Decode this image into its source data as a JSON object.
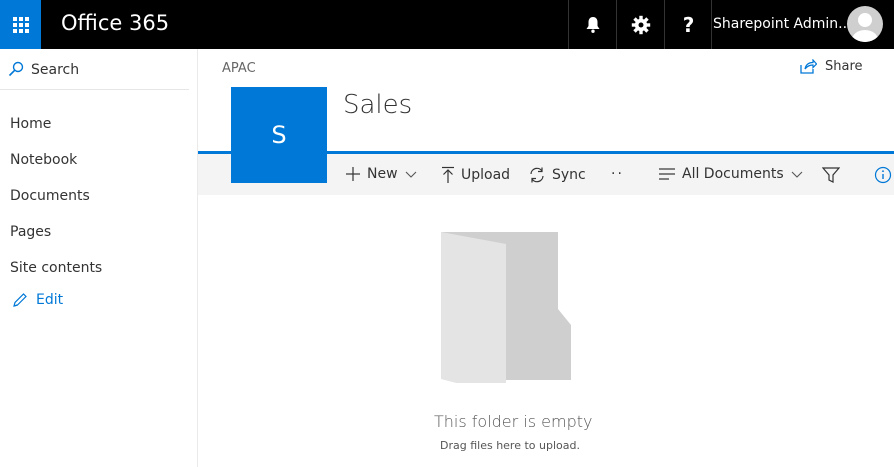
{
  "header": {
    "brand": "Office 365",
    "user_name": "Sharepoint Admin...",
    "icons": [
      "waffle-icon",
      "bell-icon",
      "gear-icon",
      "help-icon",
      "avatar-icon"
    ],
    "help_glyph": "?"
  },
  "sidebar": {
    "search_label": "Search",
    "items": [
      {
        "label": "Home"
      },
      {
        "label": "Notebook"
      },
      {
        "label": "Documents"
      },
      {
        "label": "Pages"
      },
      {
        "label": "Site contents"
      }
    ],
    "edit_label": "Edit"
  },
  "site": {
    "breadcrumb": "APAC",
    "title": "Sales",
    "logo_letter": "S",
    "share_label": "Share"
  },
  "commands": {
    "new": "New",
    "upload": "Upload",
    "sync": "Sync",
    "more": "··",
    "view": "All Documents"
  },
  "empty": {
    "title": "This folder is empty",
    "subtitle": "Drag files here to upload."
  },
  "colors": {
    "accent": "#0078d7",
    "topbar": "#000000",
    "cmdbar": "#f4f4f4"
  }
}
